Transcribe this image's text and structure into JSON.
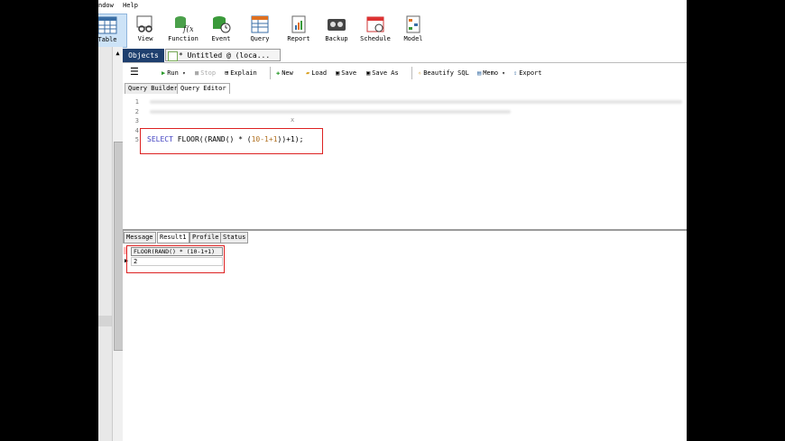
{
  "menubar": {
    "items": [
      "ndow",
      "Help"
    ]
  },
  "toolbar": {
    "items": [
      {
        "label": "Table",
        "icon": "table-icon"
      },
      {
        "label": "View",
        "icon": "view-icon"
      },
      {
        "label": "Function",
        "icon": "function-icon"
      },
      {
        "label": "Event",
        "icon": "event-icon"
      },
      {
        "label": "Query",
        "icon": "query-icon"
      },
      {
        "label": "Report",
        "icon": "report-icon"
      },
      {
        "label": "Backup",
        "icon": "backup-icon"
      },
      {
        "label": "Schedule",
        "icon": "schedule-icon"
      },
      {
        "label": "Model",
        "icon": "model-icon"
      }
    ]
  },
  "tabs": {
    "objects": "Objects",
    "untitled": "* Untitled @        (loca..."
  },
  "querybar": {
    "run": "Run",
    "stop": "Stop",
    "explain": "Explain",
    "new": "New",
    "load": "Load",
    "save": "Save",
    "saveas": "Save As",
    "beautify": "Beautify SQL",
    "memo": "Memo",
    "export": "Export"
  },
  "subtabs": {
    "builder": "Query Builder",
    "editor": "Query Editor"
  },
  "editor": {
    "lines": [
      "1",
      "2",
      "3",
      "4",
      "5"
    ],
    "sql_kw": "SELECT",
    "sql_rest": " FLOOR((RAND() * (",
    "sql_num": "10-1+1",
    "sql_end": "))+1);",
    "cursor": "x"
  },
  "result_tabs": [
    "Message",
    "Result1",
    "Profile",
    "Status"
  ],
  "result": {
    "header": "FLOOR(RAND() * (10-1+1)",
    "value": "2"
  },
  "colors": {
    "accent": "#1e3f6e",
    "highlight": "#dd2222"
  }
}
